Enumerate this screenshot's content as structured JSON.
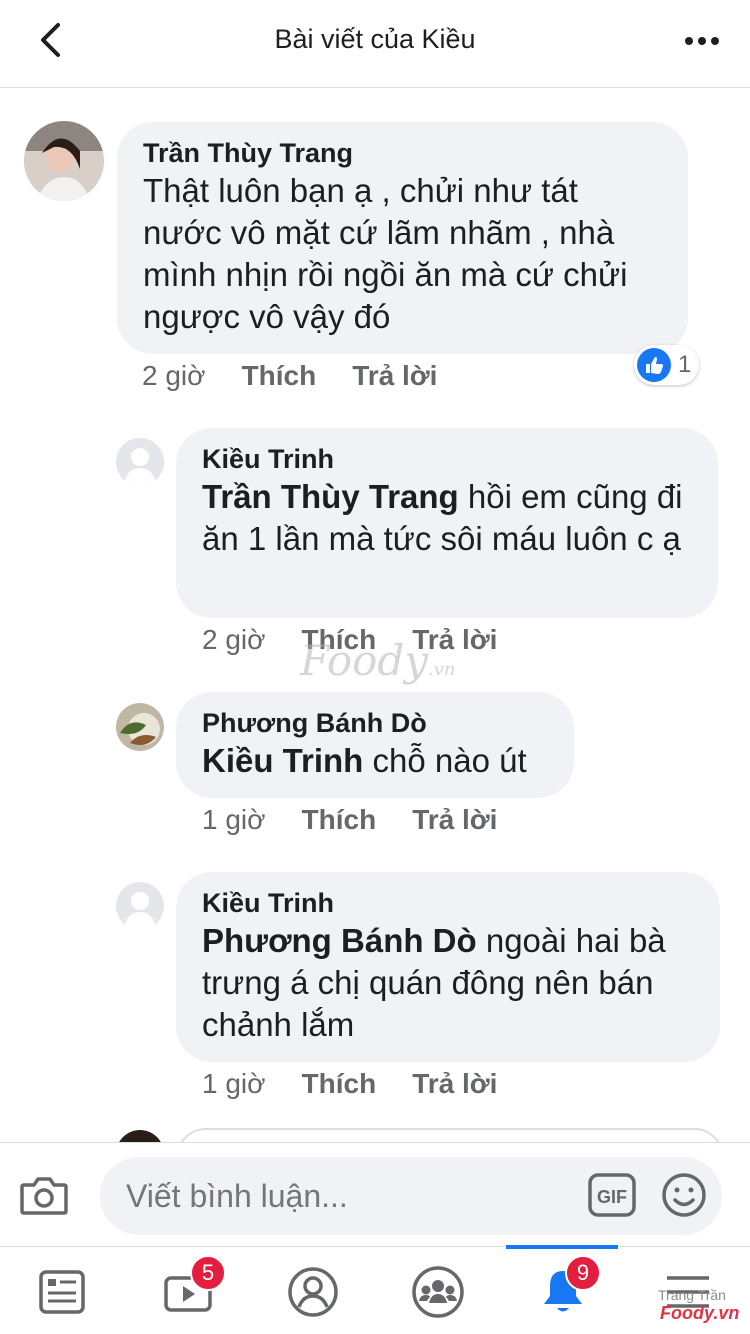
{
  "header": {
    "title": "Bài viết của Kiều"
  },
  "comments": [
    {
      "author": "Trần Thùy Trang",
      "mention": "",
      "text": "Thật luôn bạn ạ , chửi như tát nước vô mặt cứ lãm nhãm , nhà mình nhịn rồi ngồi ăn mà cứ chửi ngược vô vậy đó",
      "time": "2 giờ",
      "like": "Thích",
      "reply": "Trả lời",
      "reaction_count": "1"
    },
    {
      "author": "Kiều Trinh",
      "mention": "Trần Thùy Trang",
      "text": " hồi em cũng đi ăn 1 lần mà tức sôi máu luôn c ạ",
      "time": "2 giờ",
      "like": "Thích",
      "reply": "Trả lời"
    },
    {
      "author": "Phương Bánh Dò",
      "mention": "Kiều Trinh",
      "text": " chỗ nào út",
      "time": "1 giờ",
      "like": "Thích",
      "reply": "Trả lời"
    },
    {
      "author": "Kiều Trinh",
      "mention": "Phương Bánh Dò",
      "text": " ngoài hai bà trưng á chị quán đông nên bán chảnh lắm",
      "time": "1 giờ",
      "like": "Thích",
      "reply": "Trả lời"
    }
  ],
  "watermark": {
    "brand": "Foody",
    "suffix": ".vn"
  },
  "composer": {
    "placeholder": "Viết bình luận...",
    "gif_label": "GIF"
  },
  "nav": {
    "watch_badge": "5",
    "notifications_badge": "9",
    "user_label": "Trang Trần",
    "brand_label": "Foody.vn"
  },
  "colors": {
    "accent": "#1877f2",
    "badge": "#e41e3f",
    "bubble": "#f0f2f5"
  }
}
